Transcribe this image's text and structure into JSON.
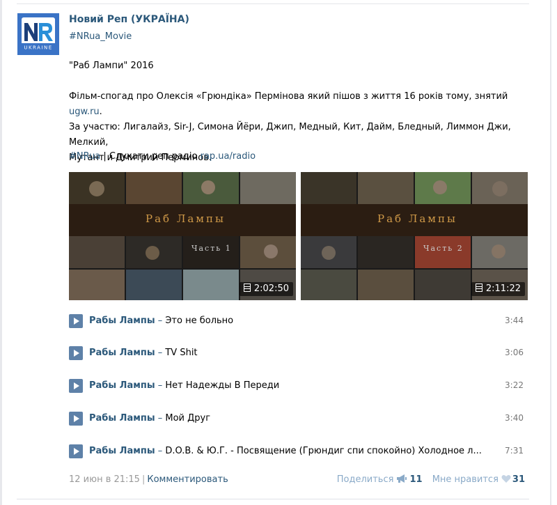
{
  "post": {
    "author": "Новий Реп (УКРАЇНА)",
    "hashtag": "#NRua_Movie",
    "title_line": "\"Раб Лампи\" 2016",
    "desc_line1_pre": "Фільм-спогад про Олексія «Грюндіка» Пермінова який пішов з життя 16 років тому, знятий ",
    "desc_link": "ugw.ru",
    "desc_line1_post": ".",
    "desc_line2": "За участю: Лигалайз, Sir-J, Симона Йёри, Джип, Медный, Кит, Дайм, Бледный, Лиммон Джи, Мелкий,",
    "desc_line3": "Мутант и Дмитрий Перминов.",
    "radio_tag": "#NRua",
    "radio_text": " | Слухати реп радіо ",
    "radio_link": "rap.ua/radio"
  },
  "avatar": {
    "logo_text": "NR",
    "logo_sub": "UKRAINE",
    "bg_color": "#3a73c6"
  },
  "videos": [
    {
      "title": "Раб Лампы",
      "part": "Часть 1",
      "duration": "2:02:50"
    },
    {
      "title": "Раб Лампы",
      "part": "Часть 2",
      "duration": "2:11:22"
    }
  ],
  "tracks": [
    {
      "artist": "Рабы Лампы",
      "sep": " – ",
      "title": "Это не больно",
      "duration": "3:44"
    },
    {
      "artist": "Рабы Лампы",
      "sep": " – ",
      "title": "TV Shit",
      "duration": "3:06"
    },
    {
      "artist": "Рабы Лампы",
      "sep": " – ",
      "title": "Нет Надежды В Переди",
      "duration": "3:22"
    },
    {
      "artist": "Рабы Лампы",
      "sep": " – ",
      "title": "Мой Друг",
      "duration": "3:40"
    },
    {
      "artist": "Рабы Лампы",
      "sep": " – ",
      "title": "D.O.B. & Ю.Г. - Посвящение (Грюндиг спи спокойно) Холодное л...",
      "duration": "7:31"
    }
  ],
  "footer": {
    "date": "12 июн в 21:15",
    "separator": "|",
    "comment": "Комментировать",
    "share_label": "Поделиться",
    "share_count": "11",
    "like_label": "Мне нравится",
    "like_count": "31"
  },
  "colors": {
    "link": "#2b587a",
    "play_button": "#5e81a8",
    "title_gold": "#d09a48"
  },
  "icons": [
    "play-icon",
    "film-icon",
    "megaphone-icon",
    "heart-icon"
  ]
}
